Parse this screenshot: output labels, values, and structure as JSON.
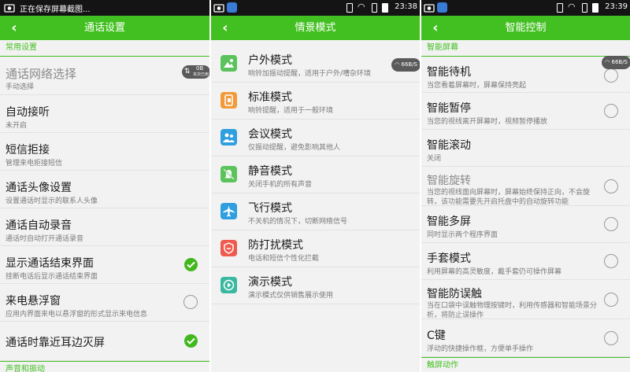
{
  "panel1": {
    "status_text": "正在保存屏幕截图...",
    "title": "通话设置",
    "sections": [
      "常用设置",
      "声音和振动"
    ],
    "toast": {
      "top": "0B",
      "bottom": "本次已用"
    },
    "rows": [
      {
        "title": "通话网络选择",
        "subtitle": "手动选择",
        "control": "none",
        "dim": true
      },
      {
        "title": "自动接听",
        "subtitle": "未开启",
        "control": "none"
      },
      {
        "title": "短信拒接",
        "subtitle": "管理来电拒接短信",
        "control": "none"
      },
      {
        "title": "通话头像设置",
        "subtitle": "设置通话时显示的联系人头像",
        "control": "none"
      },
      {
        "title": "通话自动录音",
        "subtitle": "通话时自动打开通话录音",
        "control": "none"
      },
      {
        "title": "显示通话结束界面",
        "subtitle": "挂断电话后显示通话结束界面",
        "control": "checked"
      },
      {
        "title": "来电悬浮窗",
        "subtitle": "应用内界面来电以悬浮窗的形式显示来电信息",
        "control": "unchecked"
      },
      {
        "title": "通话时靠近耳边灭屏",
        "subtitle": "",
        "control": "checked"
      }
    ]
  },
  "panel2": {
    "time": "23:38",
    "title": "情景模式",
    "toast": "66B/S",
    "modes": [
      {
        "title": "户外模式",
        "subtitle": "响铃加振动提醒，适用于户外/嘈杂环境",
        "icon": "outdoor-icon",
        "color": "#5cc35c"
      },
      {
        "title": "标准模式",
        "subtitle": "响铃提醒，适用于一般环境",
        "icon": "standard-icon",
        "color": "#f29a3a"
      },
      {
        "title": "会议模式",
        "subtitle": "仅振动提醒，避免影响其他人",
        "icon": "meeting-icon",
        "color": "#2f9fe0"
      },
      {
        "title": "静音模式",
        "subtitle": "关闭手机的所有声音",
        "icon": "silent-icon",
        "color": "#5cc35c"
      },
      {
        "title": "飞行模式",
        "subtitle": "不关机的情况下，切断网络信号",
        "icon": "airplane-icon",
        "color": "#2f9fe0"
      },
      {
        "title": "防打扰模式",
        "subtitle": "电话和短信个性化拦截",
        "icon": "no-disturb-icon",
        "color": "#ef5a4e"
      },
      {
        "title": "演示模式",
        "subtitle": "演示模式仅供销售展示使用",
        "icon": "demo-icon",
        "color": "#3ab8a0"
      }
    ]
  },
  "panel3": {
    "time": "23:39",
    "title": "智能控制",
    "sections": [
      "智能屏幕",
      "触屏动作"
    ],
    "toast": "66B/S",
    "rows": [
      {
        "title": "智能待机",
        "subtitle": "当您看着屏幕时，屏幕保持亮起",
        "control": "unchecked"
      },
      {
        "title": "智能暂停",
        "subtitle": "当您的视线离开屏幕时，视频暂停播放",
        "control": "unchecked"
      },
      {
        "title": "智能滚动",
        "subtitle": "关闭",
        "control": "none"
      },
      {
        "title": "智能旋转",
        "subtitle": "当您的视线面向屏幕时，屏幕始终保持正向，不会旋",
        "subtitle2": "转，该功能需要先开启托盘中的自动旋转功能",
        "control": "unchecked",
        "dim": true,
        "tall": true
      },
      {
        "title": "智能多屏",
        "subtitle": "同时显示两个程序界面",
        "control": "unchecked"
      },
      {
        "title": "手套模式",
        "subtitle": "利用屏幕的高灵敏度，戴手套仍可操作屏幕",
        "control": "unchecked"
      },
      {
        "title": "智能防误触",
        "subtitle": "当在口袋中误触物理按键时，利用传感器和智能场景分",
        "subtitle2": "析，将防止误操作",
        "control": "unchecked",
        "tall": true
      },
      {
        "title": "C键",
        "subtitle": "浮动的快捷操作框，方便单手操作",
        "control": "unchecked"
      }
    ]
  },
  "colors": {
    "accent": "#43c021",
    "statusbar": "#141414",
    "background": "#f2f2f2"
  }
}
